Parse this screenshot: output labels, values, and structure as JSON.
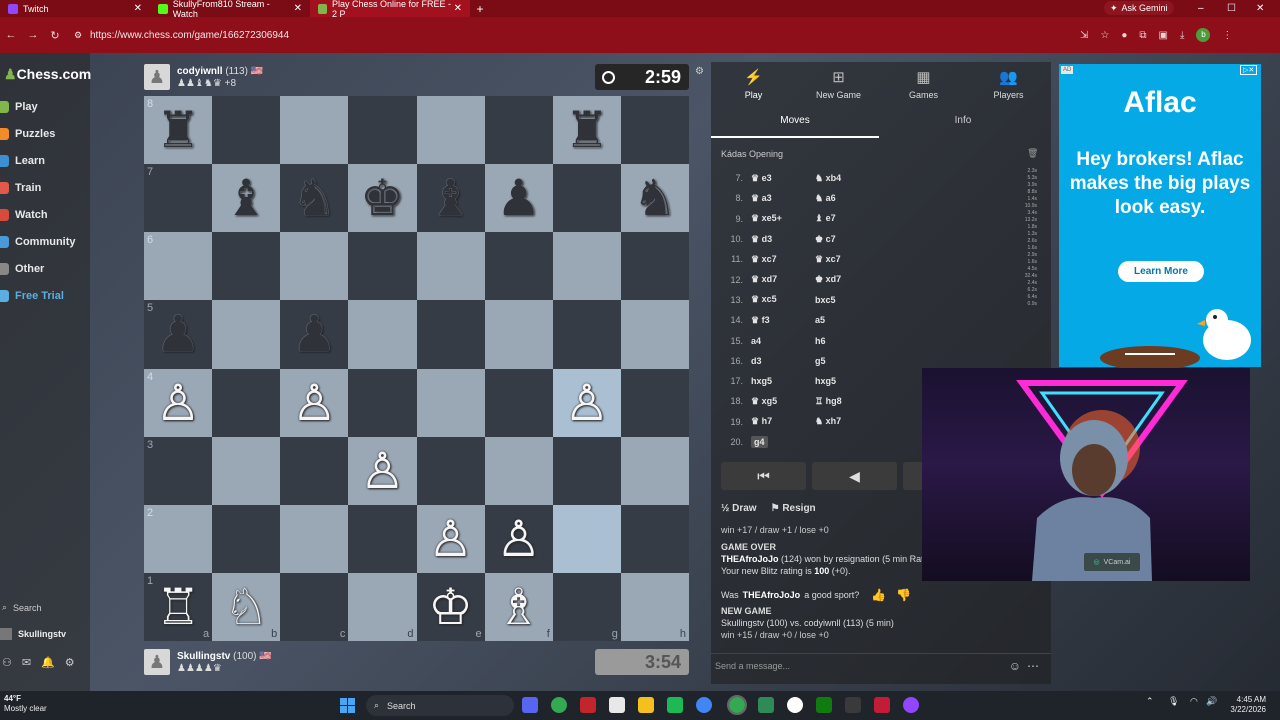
{
  "browser": {
    "tabs": [
      {
        "title": "Twitch",
        "favicon_color": "#9146ff"
      },
      {
        "title": "SkullyFrom810 Stream - Watch",
        "favicon_color": "#53fc18"
      },
      {
        "title": "Play Chess Online for FREE - 2 P",
        "favicon_color": "#81b64c"
      }
    ],
    "new_tab": "+",
    "url": "https://www.chess.com/game/166272306944",
    "ask_gemini": "Ask Gemini",
    "profile_initial": "b",
    "window_controls": {
      "minimize": "–",
      "maximize": "☐",
      "close": "✕"
    }
  },
  "sidebar": {
    "logo": "Chess.com",
    "items": [
      {
        "label": "Play",
        "color": "#81b64c"
      },
      {
        "label": "Puzzles",
        "color": "#f28c28"
      },
      {
        "label": "Learn",
        "color": "#3e8ed0"
      },
      {
        "label": "Train",
        "color": "#e05a4c"
      },
      {
        "label": "Watch",
        "color": "#d84a3a"
      },
      {
        "label": "Community",
        "color": "#4a9ad8"
      },
      {
        "label": "Other",
        "color": "#888888"
      },
      {
        "label": "Free Trial",
        "color": "#5aaee0"
      }
    ],
    "search": "Search",
    "user": "Skullingstv"
  },
  "game": {
    "top_player": {
      "name": "codyiwnll",
      "rating": "(113)",
      "flag": "🇺🇸",
      "captured": "♟♟♝♞♛ +8",
      "clock": "2:59"
    },
    "bottom_player": {
      "name": "Skullingstv",
      "rating": "(100)",
      "flag": "🇺🇸",
      "captured": "♟♟♟♟♛",
      "clock": "3:54"
    },
    "files": [
      "a",
      "b",
      "c",
      "d",
      "e",
      "f",
      "g",
      "h"
    ],
    "ranks": [
      "8",
      "7",
      "6",
      "5",
      "4",
      "3",
      "2",
      "1"
    ],
    "board": [
      [
        "b:♜",
        "",
        "",
        "",
        "",
        "",
        "b:♜",
        ""
      ],
      [
        "",
        "b:♝",
        "b:♞",
        "b:♚",
        "b:♝",
        "b:♟",
        "",
        "b:♞"
      ],
      [
        "",
        "",
        "",
        "",
        "",
        "",
        "",
        ""
      ],
      [
        "b:♟",
        "",
        "b:♟",
        "",
        "",
        "",
        "",
        ""
      ],
      [
        "w:♙",
        "",
        "w:♙",
        "",
        "",
        "",
        "w:♙",
        ""
      ],
      [
        "",
        "",
        "",
        "w:♙",
        "",
        "",
        "",
        ""
      ],
      [
        "",
        "",
        "",
        "",
        "w:♙",
        "w:♙",
        "",
        ""
      ],
      [
        "w:♖",
        "w:♘",
        "",
        "",
        "w:♔",
        "w:♗",
        "",
        ""
      ]
    ],
    "highlighted_squares": [
      "g4",
      "g2"
    ]
  },
  "panel": {
    "nav": [
      {
        "label": "Play",
        "glyph": "⚡"
      },
      {
        "label": "New Game",
        "glyph": "⊞"
      },
      {
        "label": "Games",
        "glyph": "▦"
      },
      {
        "label": "Players",
        "glyph": "👥"
      }
    ],
    "subtabs": [
      "Moves",
      "Info"
    ],
    "opening": "Kádas Opening",
    "moves": [
      {
        "n": "7.",
        "w": "♛ e3",
        "b": "♞ xb4"
      },
      {
        "n": "8.",
        "w": "♛ a3",
        "b": "♞ a6"
      },
      {
        "n": "9.",
        "w": "♛ xe5+",
        "b": "♝ e7"
      },
      {
        "n": "10.",
        "w": "♛ d3",
        "b": "♚ c7"
      },
      {
        "n": "11.",
        "w": "♛ xc7",
        "b": "♛ xc7"
      },
      {
        "n": "12.",
        "w": "♛ xd7",
        "b": "♚ xd7"
      },
      {
        "n": "13.",
        "w": "♛ xc5",
        "b": "bxc5"
      },
      {
        "n": "14.",
        "w": "♛ f3",
        "b": "a5"
      },
      {
        "n": "15.",
        "w": "a4",
        "b": "h6"
      },
      {
        "n": "16.",
        "w": "d3",
        "b": "g5"
      },
      {
        "n": "17.",
        "w": "hxg5",
        "b": "hxg5"
      },
      {
        "n": "18.",
        "w": "♛ xg5",
        "b": "♖ hg8"
      },
      {
        "n": "19.",
        "w": "♛ h7",
        "b": "♞ xh7"
      },
      {
        "n": "20.",
        "w": "g4",
        "b": ""
      }
    ],
    "move_times": [
      "2.3s",
      "5.3s",
      "3.9s",
      "8.8s",
      "1.4s",
      "10.9s",
      "3.4s",
      "13.2s",
      "1.8s",
      "1.3s",
      "2.6s",
      "1.6s",
      "2.9s",
      "1.6s",
      "4.5s",
      "32.4s",
      "2.4s",
      "6.2s",
      "6.4s",
      "0.9s"
    ],
    "controls": [
      "⏮",
      "◀",
      "▶"
    ],
    "draw": "Draw",
    "resign": "Resign",
    "stats_line_1": "win +17 / draw +1 / lose +0",
    "game_over_title": "GAME OVER",
    "game_over_winner": "THEAfroJoJo",
    "game_over_text": "(124) won by resignation (5 min Rated",
    "new_rating_text": "Your new Blitz rating is",
    "new_rating_value": "100",
    "new_rating_delta": "(+0).",
    "good_sport_prefix": "Was",
    "good_sport_name": "THEAfroJoJo",
    "good_sport_suffix": "a good sport?",
    "new_game_title": "NEW GAME",
    "new_game_text": "Skullingstv (100) vs. codyiwnll (113) (5 min)",
    "stats_line_2": "win +15 / draw +0 / lose +0",
    "chat_placeholder": "Send a message..."
  },
  "ad": {
    "tag": "AD",
    "logo": "Aflac",
    "headline": "Hey brokers! Aflac makes the big plays look easy.",
    "cta": "Learn More",
    "bg": "#05a9e5"
  },
  "webcam": {
    "overlay_label": "VCam.ai"
  },
  "taskbar": {
    "temp": "44°F",
    "weather": "Mostly clear",
    "search": "Search",
    "time": "4:45 AM",
    "date": "3/22/2026"
  }
}
